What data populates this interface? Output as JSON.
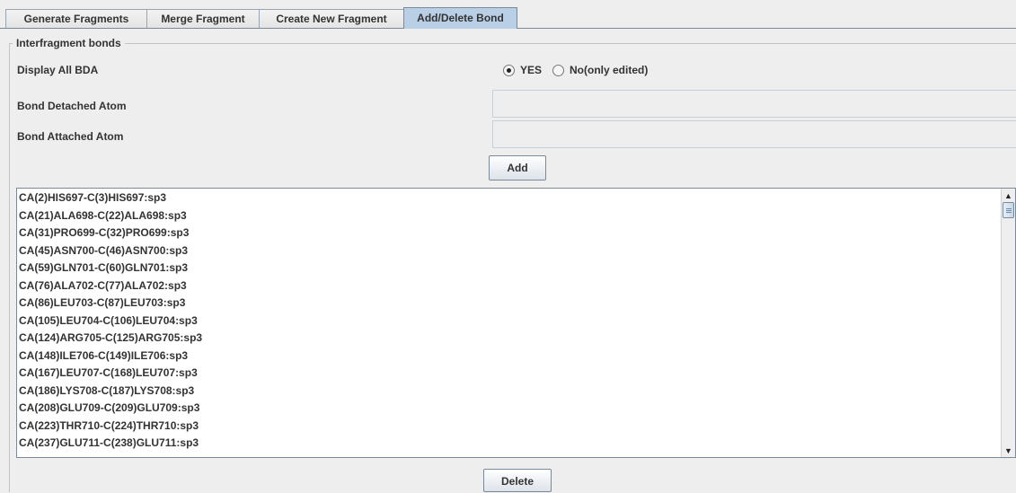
{
  "tabs": [
    {
      "label": "Generate Fragments",
      "active": false
    },
    {
      "label": "Merge Fragment",
      "active": false
    },
    {
      "label": "Create New Fragment",
      "active": false
    },
    {
      "label": "Add/Delete Bond",
      "active": true
    }
  ],
  "group": {
    "title": "Interfragment bonds",
    "display_all_bda": {
      "label": "Display All BDA",
      "options": [
        {
          "label": "YES",
          "selected": true
        },
        {
          "label": "No(only edited)",
          "selected": false
        }
      ]
    },
    "bond_detached_atom": {
      "label": "Bond Detached Atom",
      "value": ""
    },
    "bond_attached_atom": {
      "label": "Bond Attached Atom",
      "value": ""
    },
    "add_label": "Add",
    "delete_label": "Delete"
  },
  "bond_list": [
    "CA(2)HIS697-C(3)HIS697:sp3",
    "CA(21)ALA698-C(22)ALA698:sp3",
    "CA(31)PRO699-C(32)PRO699:sp3",
    "CA(45)ASN700-C(46)ASN700:sp3",
    "CA(59)GLN701-C(60)GLN701:sp3",
    "CA(76)ALA702-C(77)ALA702:sp3",
    "CA(86)LEU703-C(87)LEU703:sp3",
    "CA(105)LEU704-C(106)LEU704:sp3",
    "CA(124)ARG705-C(125)ARG705:sp3",
    "CA(148)ILE706-C(149)ILE706:sp3",
    "CA(167)LEU707-C(168)LEU707:sp3",
    "CA(186)LYS708-C(187)LYS708:sp3",
    "CA(208)GLU709-C(209)GLU709:sp3",
    "CA(223)THR710-C(224)THR710:sp3",
    "CA(237)GLU711-C(238)GLU711:sp3"
  ],
  "icons": {
    "scroll_up": "up-arrow-icon",
    "scroll_down": "down-arrow-icon",
    "radio_selected": "radio-selected-icon",
    "radio_unselected": "radio-unselected-icon"
  },
  "colors": {
    "active_tab": "#b8cfe5",
    "panel_bg": "#eeeeee",
    "border": "#7a8a99"
  }
}
